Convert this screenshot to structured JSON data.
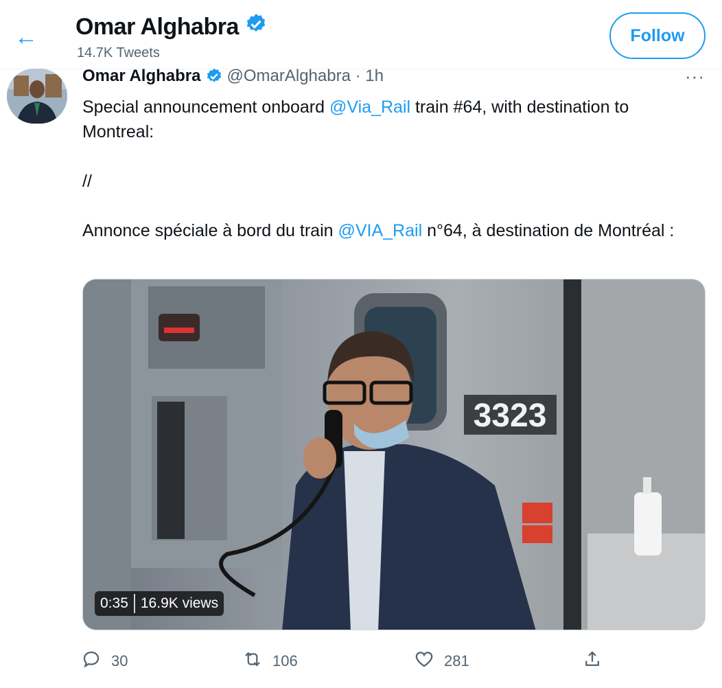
{
  "header": {
    "name": "Omar Alghabra",
    "tweet_count": "14.7K Tweets",
    "follow_label": "Follow"
  },
  "tweet": {
    "name": "Omar Alghabra",
    "handle_time": "@OmarAlghabra · 1h",
    "more": "···",
    "line1_pre": "Special announcement onboard ",
    "line1_link": "@Via_Rail",
    "line1_post": " train #64, with destination to Montreal:",
    "separator": "//",
    "line2_pre": "Annonce spéciale à bord du train ",
    "line2_link": "@VIA_Rail",
    "line2_post": " n°64, à destination de Montréal :",
    "media": {
      "car_number": "3323",
      "duration": "0:35",
      "views": "16.9K views"
    },
    "actions": {
      "replies": "30",
      "retweets": "106",
      "likes": "281"
    }
  },
  "colors": {
    "accent": "#1d9bf0",
    "text": "#0f1419",
    "secondary": "#536471"
  },
  "icons": [
    "back-arrow-icon",
    "verified-badge-icon",
    "more-icon",
    "reply-icon",
    "retweet-icon",
    "like-icon",
    "share-icon"
  ]
}
